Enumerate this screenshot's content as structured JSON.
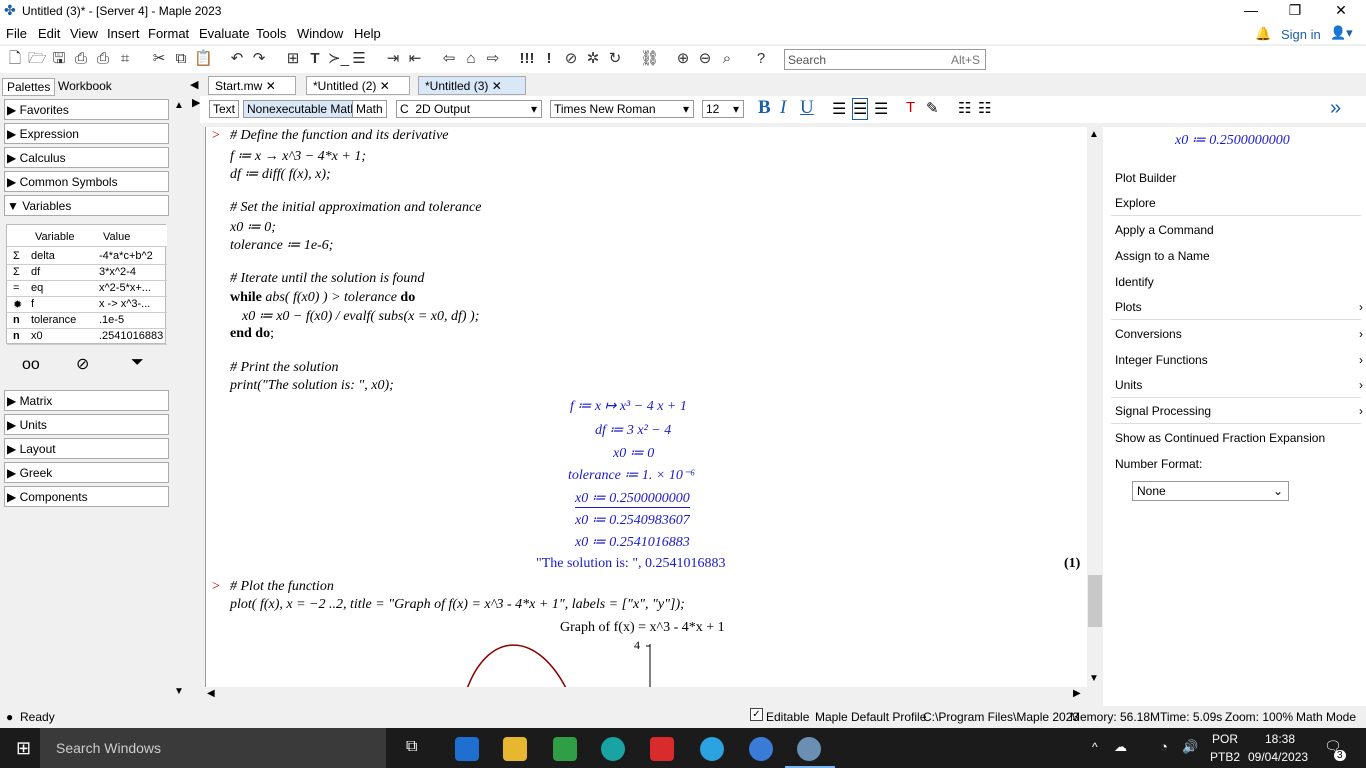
{
  "window": {
    "title": "Untitled (3)* - [Server 4] - Maple 2023"
  },
  "menu": [
    "File",
    "Edit",
    "View",
    "Insert",
    "Format",
    "Evaluate",
    "Tools",
    "Window",
    "Help"
  ],
  "account": {
    "sign_in": "Sign in"
  },
  "search": {
    "placeholder": "Search",
    "shortcut": "Alt+S"
  },
  "left_tabs": {
    "palettes": "Palettes",
    "workbook": "Workbook"
  },
  "palettes_top": [
    "Favorites",
    "Expression",
    "Calculus",
    "Common Symbols",
    "Variables"
  ],
  "variables": {
    "headers": {
      "variable": "Variable",
      "value": "Value"
    },
    "rows": [
      {
        "icon": "Σ",
        "name": "delta",
        "value": "-4*a*c+b^2"
      },
      {
        "icon": "Σ",
        "name": "df",
        "value": "3*x^2-4"
      },
      {
        "icon": "=",
        "name": "eq",
        "value": "x^2-5*x+..."
      },
      {
        "icon": "✹",
        "name": "f",
        "value": "x -> x^3-..."
      },
      {
        "icon": "n",
        "name": "tolerance",
        "value": ".1e-5"
      },
      {
        "icon": "n",
        "name": "x0",
        "value": ".2541016883"
      }
    ]
  },
  "palettes_bottom": [
    "Matrix",
    "Units",
    "Layout",
    "Greek",
    "Components"
  ],
  "doc_tabs": [
    "Start.mw",
    "*Untitled (2)",
    "*Untitled (3)"
  ],
  "format": {
    "text": "Text",
    "nonexec": "Nonexecutable Math",
    "math": "Math",
    "output": "2D Output",
    "font": "Times New Roman",
    "size": "12"
  },
  "code": {
    "l1": "# Define the function and its derivative",
    "l2": "f ≔ x → x^3 − 4*x + 1;",
    "l3": "df ≔ diff( f(x), x);",
    "l4": "# Set the initial approximation and tolerance",
    "l5": "x0 ≔ 0;",
    "l6": "tolerance ≔ 1e-6;",
    "l7": "# Iterate until the solution is found",
    "l8a": "while",
    "l8b": " abs( f(x0) ) > tolerance ",
    "l8c": "do",
    "l9": "x0 ≔ x0 − f(x0) / evalf( subs(x = x0, df) );",
    "l10a": "end do",
    "l10b": ";",
    "l11": "# Print the solution",
    "l12": "print(\"The solution is: \", x0);",
    "l13": "# Plot the function",
    "l14": "plot( f(x), x = −2 ..2, title = \"Graph of f(x) = x^3 - 4*x + 1\", labels = [\"x\", \"y\"]);"
  },
  "output": {
    "o1": "f ≔ x ↦ x³ − 4 x + 1",
    "o2": "df ≔ 3 x² − 4",
    "o3": "x0 ≔ 0",
    "o4": "tolerance ≔ 1. × 10⁻⁶",
    "o5": "x0 ≔ 0.2500000000",
    "o6": "x0 ≔ 0.2540983607",
    "o7": "x0 ≔ 0.2541016883",
    "o8": "\"The solution is: \", 0.2541016883",
    "label": "(1)",
    "plot_title": "Graph of f(x) = x^3 - 4*x + 1",
    "plot_tick": "4"
  },
  "right_panel": {
    "header": "x0 ≔ 0.2500000000",
    "items": [
      "Plot Builder",
      "Explore",
      "Apply a Command",
      "Assign to a Name",
      "Identify",
      "Plots",
      "Conversions",
      "Integer Functions",
      "Units",
      "Signal Processing",
      "Show as Continued Fraction Expansion",
      "Number Format:"
    ],
    "number_format": "None"
  },
  "status": {
    "ready": "Ready",
    "editable": "Editable",
    "profile": "Maple Default Profile",
    "path": "C:\\Program Files\\Maple 2023",
    "memory": "Memory: 56.18M",
    "time": "Time: 5.09s",
    "zoom": "Zoom: 100%",
    "mode": "Math Mode"
  },
  "taskbar": {
    "search": "Search Windows",
    "lang1": "POR",
    "lang2": "PTB2",
    "time": "18:38",
    "date": "09/04/2023",
    "notif": "3"
  }
}
